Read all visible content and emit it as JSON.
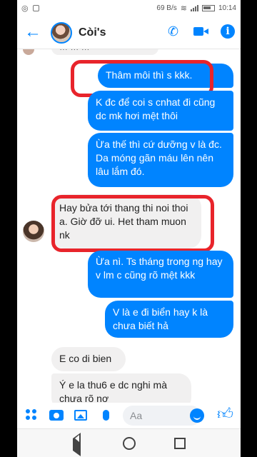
{
  "status_bar": {
    "speed": "69 B/s",
    "time": "10:14"
  },
  "header": {
    "contact_name": "Còi's"
  },
  "messages": [
    {
      "side": "in",
      "text": "… … …"
    },
    {
      "side": "out",
      "text": "Thâm môi thì s kkk."
    },
    {
      "side": "out",
      "text": "K đc để coi s cnhat đi cũng dc mk hơi mệt thôi"
    },
    {
      "side": "out",
      "text": "Ừa thế thì cứ dưỡng v là đc. Da móng gãn máu lên nên lâu lắm đó."
    },
    {
      "side": "in",
      "text": "Hay bửa tới thang thi noi thoi a. Giờ đỡ ui. Het tham muon nk"
    },
    {
      "side": "out",
      "text": "Ừa nì. Ts tháng trong ng hay v lm c cũng rõ mệt kkk"
    },
    {
      "side": "out",
      "text": "V là e đi biển hay k là chưa biết hả"
    },
    {
      "side": "in",
      "text": "E co di bien"
    },
    {
      "side": "in",
      "text": "Ý e la thu6 e dc nghi mà chưa rõ nơ"
    }
  ],
  "composer": {
    "placeholder": "Aa"
  },
  "colors": {
    "messenger_blue": "#0084ff",
    "highlight_red": "#e8242b"
  },
  "icons": [
    "back-arrow",
    "phone",
    "video-camera",
    "info",
    "grid-dots",
    "camera",
    "image",
    "microphone",
    "smiley",
    "thumbs-up"
  ]
}
